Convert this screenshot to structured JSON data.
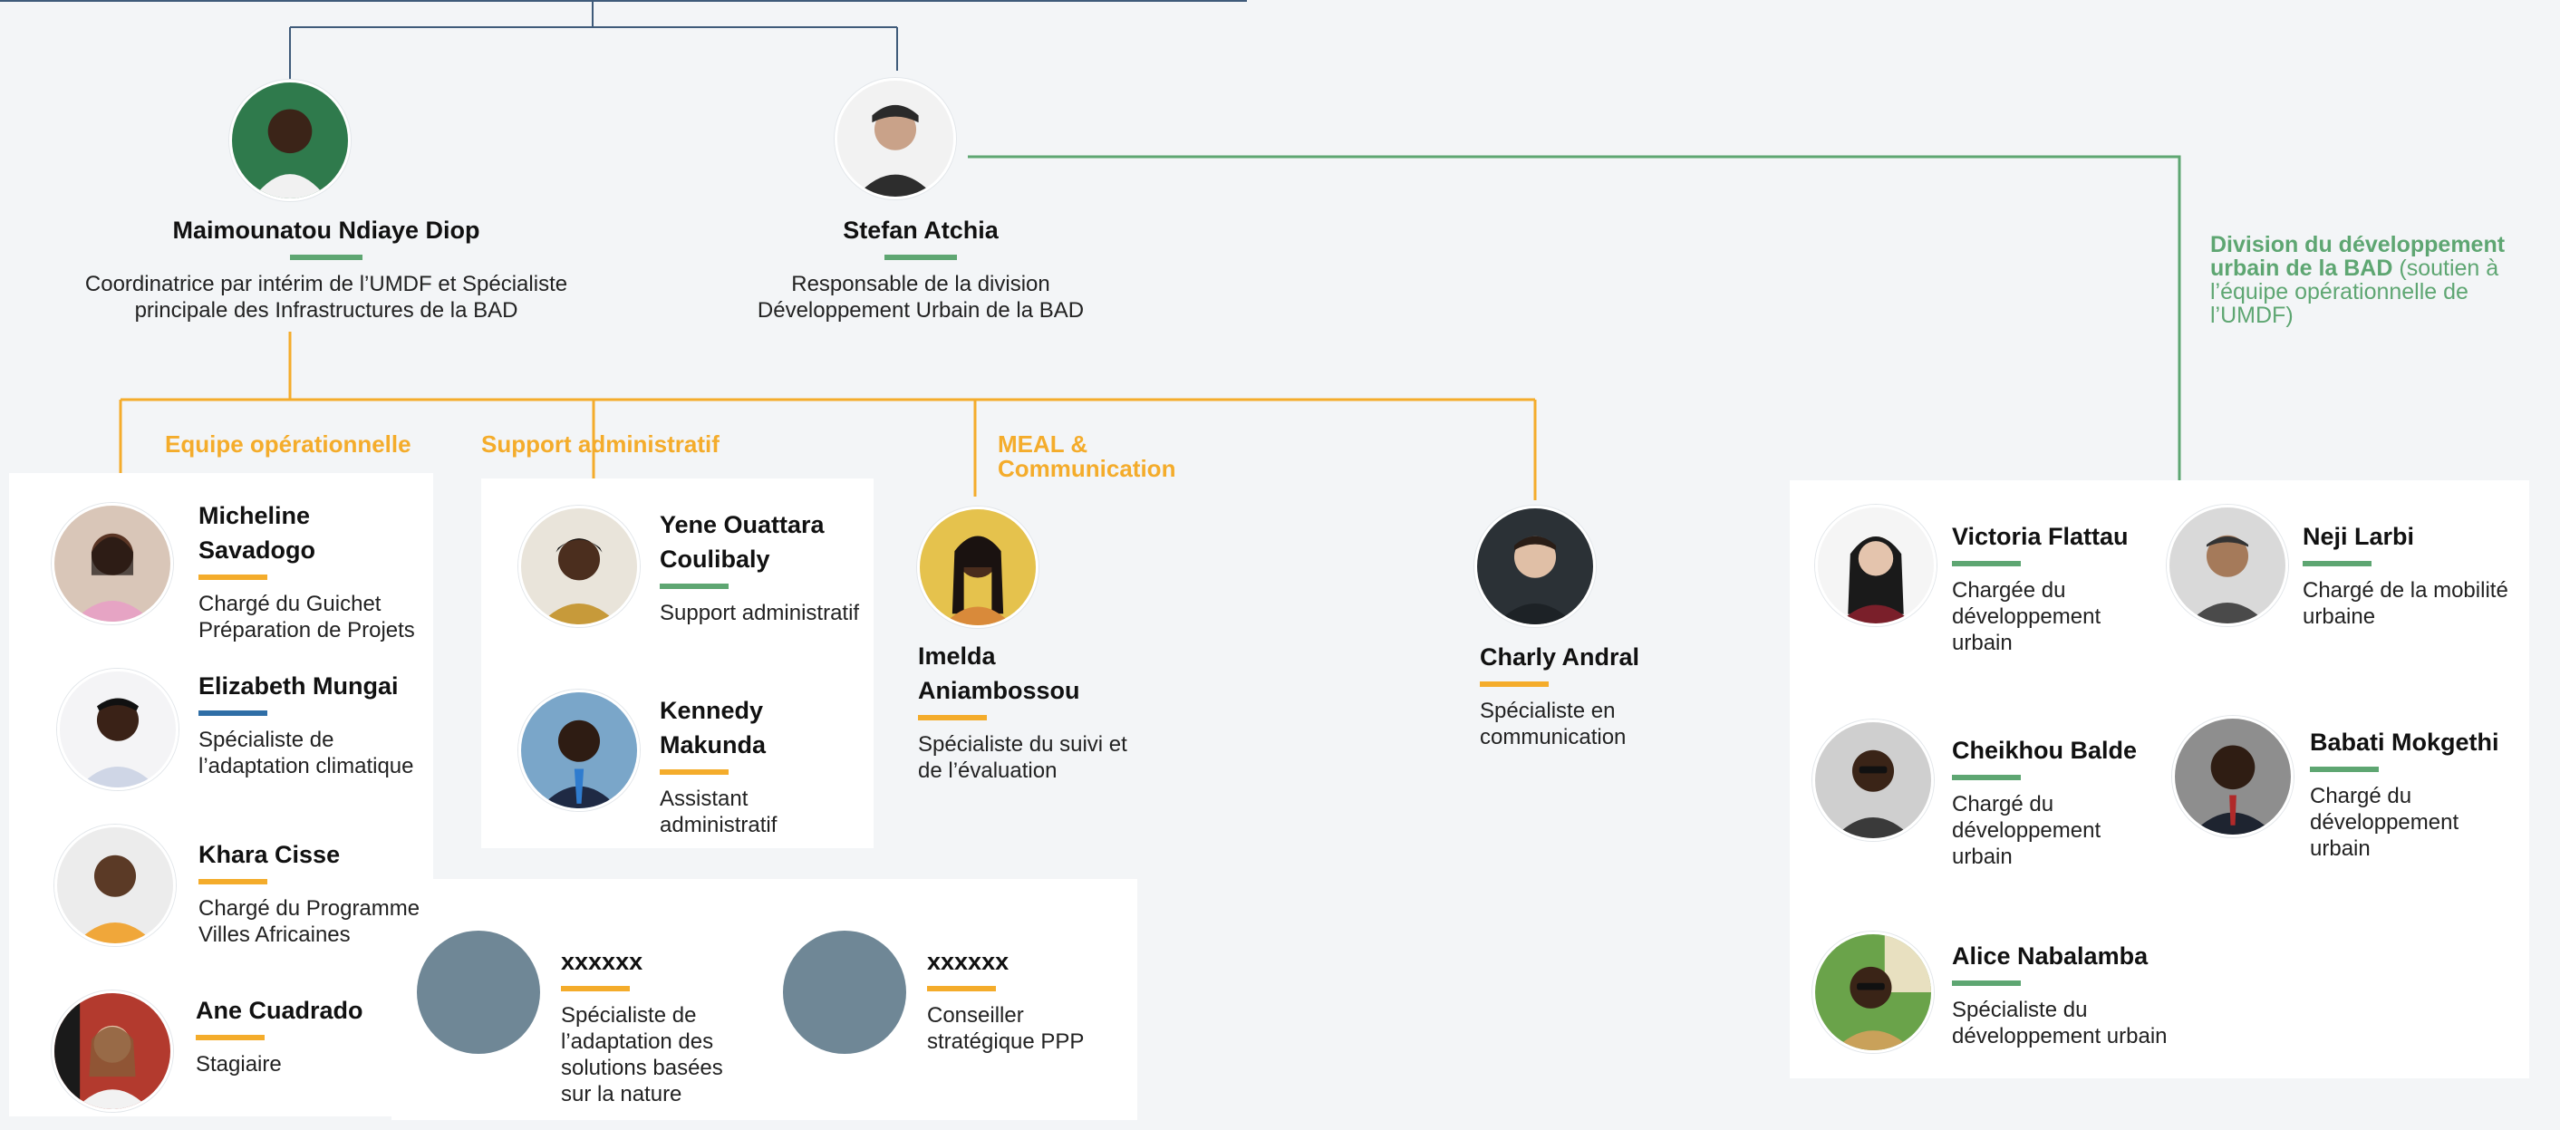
{
  "colors": {
    "accent_yellow": "#f4ac2b",
    "accent_green": "#5ea672",
    "accent_blue": "#2f6ea6",
    "top_line": "#3f5b7a",
    "placeholder": "#6f8796",
    "background": "#f3f5f7"
  },
  "leaders": [
    {
      "name": "Maimounatou Ndiaye Diop",
      "role": "Coordinatrice par intérim de l’UMDF et Spécialiste principale des Infrastructures de la BAD"
    },
    {
      "name": "Stefan Atchia",
      "role": "Responsable de la division Développement Urbain de la BAD"
    }
  ],
  "teams": {
    "operational": {
      "label": "Equipe opérationnelle",
      "members": [
        {
          "name": "Micheline Savadogo",
          "role": "Chargé du Guichet Préparation de Projets"
        },
        {
          "name": "Elizabeth Mungai",
          "role": "Spécialiste de l’adaptation climatique"
        },
        {
          "name": "Khara Cisse",
          "role": "Chargé du Programme Villes Africaines"
        },
        {
          "name": "Ane Cuadrado",
          "role": "Stagiaire"
        }
      ]
    },
    "admin": {
      "label": "Support administratif",
      "members": [
        {
          "name": "Yene Ouattara Coulibaly",
          "role": "Support administratif"
        },
        {
          "name": "Kennedy Makunda",
          "role": "Assistant administratif"
        }
      ]
    },
    "meal": {
      "label": "MEAL & Communication",
      "members": [
        {
          "name": "Imelda Aniambossou",
          "role": "Spécialiste du suivi et de l’évaluation"
        },
        {
          "name": "Charly Andral",
          "role": "Spécialiste en communication"
        }
      ]
    },
    "vacancies": [
      {
        "name": "xxxxxx",
        "role": "Spécialiste de l’adaptation des solutions basées sur la nature"
      },
      {
        "name": "xxxxxx",
        "role": "Conseiller stratégique PPP"
      }
    ],
    "division": {
      "label_bold": "Division du développement urbain de la BAD",
      "label_rest": " (soutien à l’équipe opérationnelle de l’UMDF)",
      "members": [
        {
          "name": "Victoria Flattau",
          "role": "Chargée du développement urbain"
        },
        {
          "name": "Neji Larbi",
          "role": "Chargé de la mobilité urbaine"
        },
        {
          "name": "Cheikhou Balde",
          "role": "Chargé du développement urbain"
        },
        {
          "name": "Babati Mokgethi",
          "role": "Chargé du développement urbain"
        },
        {
          "name": "Alice Nabalamba",
          "role": "Spécialiste du développement urbain"
        }
      ]
    }
  }
}
